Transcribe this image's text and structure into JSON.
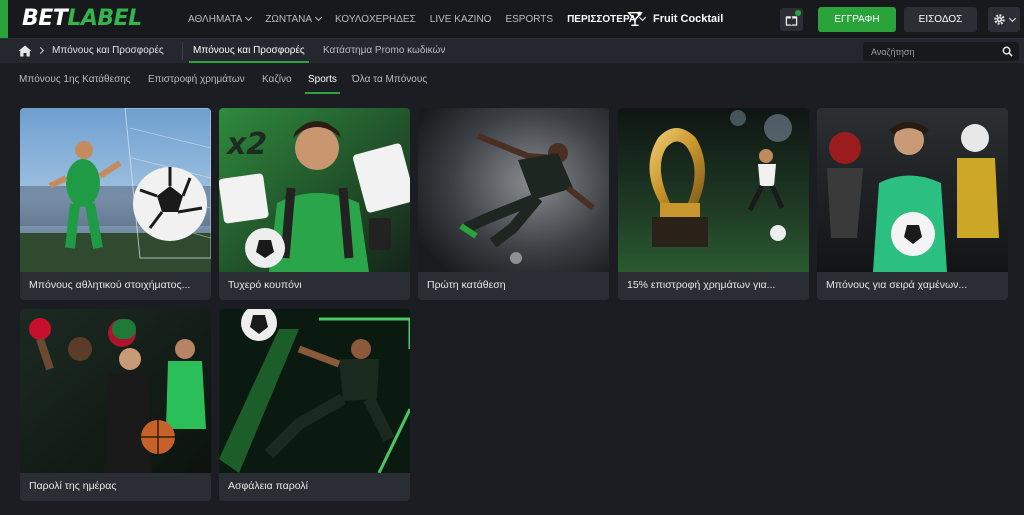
{
  "brand": {
    "part1": "BET",
    "part2": "LABEL"
  },
  "nav": {
    "items": [
      {
        "label": "ΑΘΛΗΜΑΤΑ",
        "caret": true
      },
      {
        "label": "ΖΩΝΤΑΝΑ",
        "caret": true
      },
      {
        "label": "ΚΟΥΛΟΧΕΡΗΔΕΣ",
        "caret": false
      },
      {
        "label": "LIVE ΚΑΖΙΝΟ",
        "caret": false
      },
      {
        "label": "ESPORTS",
        "caret": false
      },
      {
        "label": "ΠΕΡΙΣΣΟΤΕΡΑ",
        "caret": true
      }
    ],
    "featured_game": "Fruit Cocktail"
  },
  "header": {
    "register_label": "ΕΓΓΡΑΦΗ",
    "login_label": "ΕΙΣΟΔΟΣ"
  },
  "breadcrumb": {
    "current": "Μπόνους και Προσφορές"
  },
  "subtabs": [
    {
      "label": "Μπόνους και Προσφορές",
      "active": true
    },
    {
      "label": "Κατάστημα Promo κωδικών",
      "active": false
    }
  ],
  "search": {
    "placeholder": "Αναζήτηση"
  },
  "category_tabs": [
    {
      "label": "Μπόνους 1ης Κατάθεσης",
      "active": false
    },
    {
      "label": "Επιστροφή χρημάτων",
      "active": false
    },
    {
      "label": "Καζίνο",
      "active": false
    },
    {
      "label": "Sports",
      "active": true
    },
    {
      "label": "Όλα τα Μπόνους",
      "active": false
    }
  ],
  "promos": [
    {
      "title": "Μπόνους αθλητικού στοιχήματος...",
      "image": "football-player-goal-net"
    },
    {
      "title": "Τυχερό κουπόνι",
      "image": "fortune-ticket-fan"
    },
    {
      "title": "Πρώτη κατάθεση",
      "image": "football-bicycle-kick"
    },
    {
      "title": "15% επιστροφή χρημάτων για...",
      "image": "trophy-stadium"
    },
    {
      "title": "Μπόνους για σειρά χαμένων...",
      "image": "multi-sport-athletes"
    },
    {
      "title": "Παρολί της ημέρας",
      "image": "boxing-basketball-tennis"
    },
    {
      "title": "Ασφάλεια παρολί",
      "image": "football-neon-kick"
    }
  ],
  "colors": {
    "accent": "#2aa33a",
    "background": "#1b1d22",
    "header": "#17191d",
    "card": "#2a2d34"
  }
}
